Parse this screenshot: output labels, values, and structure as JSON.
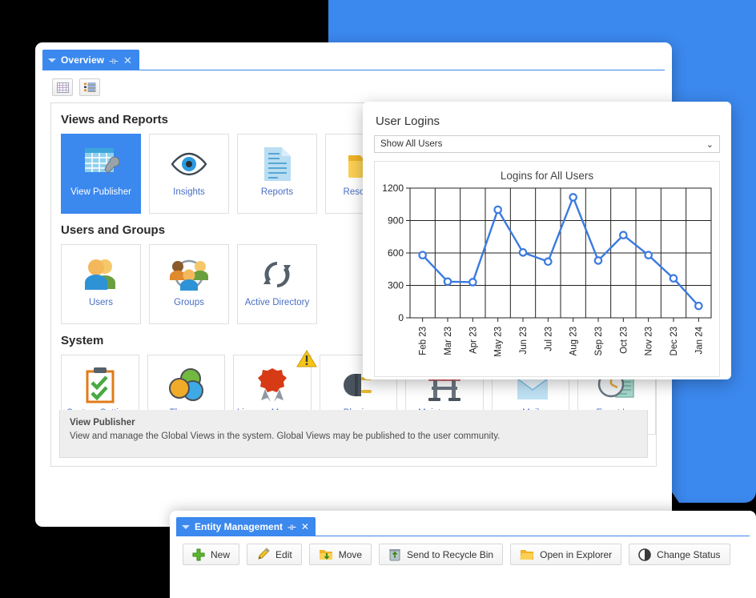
{
  "window": {
    "tab": {
      "label": "Overview",
      "caret_icon": "caret-down-icon",
      "pin_icon": "pin-icon",
      "close_icon": "close-icon"
    },
    "view_toggles": [
      {
        "name": "grid-view-button",
        "icon": "grid-icon"
      },
      {
        "name": "list-view-button",
        "icon": "list-icon"
      }
    ]
  },
  "sections": [
    {
      "title": "Views and Reports",
      "tiles": [
        {
          "label": "View Publisher",
          "icon": "view-publisher-icon",
          "selected": true
        },
        {
          "label": "Insights",
          "icon": "eye-icon",
          "selected": false
        },
        {
          "label": "Reports",
          "icon": "document-icon",
          "selected": false
        },
        {
          "label": "Resources",
          "icon": "folder-icon",
          "selected": false
        }
      ]
    },
    {
      "title": "Users and Groups",
      "tiles": [
        {
          "label": "Users",
          "icon": "users-icon",
          "selected": false
        },
        {
          "label": "Groups",
          "icon": "groups-icon",
          "selected": false
        },
        {
          "label": "Active Directory",
          "icon": "sync-arrows-icon",
          "selected": false
        }
      ]
    },
    {
      "title": "System",
      "tiles": [
        {
          "label": "System Settings",
          "icon": "clipboard-check-icon",
          "selected": false
        },
        {
          "label": "Themes",
          "icon": "color-circles-icon",
          "selected": false
        },
        {
          "label": "License Manager",
          "icon": "award-ribbon-icon",
          "selected": false,
          "warning": true
        },
        {
          "label": "Plugins",
          "icon": "plug-icon",
          "selected": false
        },
        {
          "label": "Maintenance Mode",
          "icon": "barrier-icon",
          "selected": false
        },
        {
          "label": "Mail",
          "icon": "envelope-icon",
          "selected": false
        },
        {
          "label": "Event Log",
          "icon": "clock-log-icon",
          "selected": false
        }
      ]
    }
  ],
  "description": {
    "title": "View Publisher",
    "text": "View and manage the Global Views in the system. Global Views may be published to the user community."
  },
  "logins_panel": {
    "title": "User Logins",
    "filter_value": "Show All Users",
    "filter_options": [
      "Show All Users"
    ],
    "chevron_icon": "chevron-down-icon"
  },
  "entity_window": {
    "tab": {
      "label": "Entity Management",
      "caret_icon": "caret-down-icon",
      "pin_icon": "pin-icon",
      "close_icon": "close-icon"
    },
    "buttons": [
      {
        "label": "New",
        "icon": "plus-green-icon"
      },
      {
        "label": "Edit",
        "icon": "pencil-icon"
      },
      {
        "label": "Move",
        "icon": "move-folder-icon"
      },
      {
        "label": "Send to Recycle Bin",
        "icon": "trash-icon"
      },
      {
        "label": "Open in Explorer",
        "icon": "folder-open-icon"
      },
      {
        "label": "Change Status",
        "icon": "half-circle-icon"
      }
    ]
  },
  "colors": {
    "accent_blue": "#3b88ee",
    "series_blue": "#3b7ae0",
    "tile_label": "#4a6fc4",
    "warning_yellow": "#f5c518"
  },
  "chart_data": {
    "type": "line",
    "title": "Logins for All Users",
    "xlabel": "",
    "ylabel": "",
    "ylim": [
      0,
      1200
    ],
    "yticks": [
      0,
      300,
      600,
      900,
      1200
    ],
    "grid": true,
    "legend": "none",
    "categories": [
      "Feb 23",
      "Mar 23",
      "Apr 23",
      "May 23",
      "Jun 23",
      "Jul 23",
      "Aug 23",
      "Sep 23",
      "Oct 23",
      "Nov 23",
      "Dec 23",
      "Jan 24"
    ],
    "series": [
      {
        "name": "Logins",
        "values": [
          580,
          335,
          330,
          1000,
          605,
          520,
          1115,
          530,
          765,
          580,
          365,
          110
        ]
      }
    ]
  }
}
